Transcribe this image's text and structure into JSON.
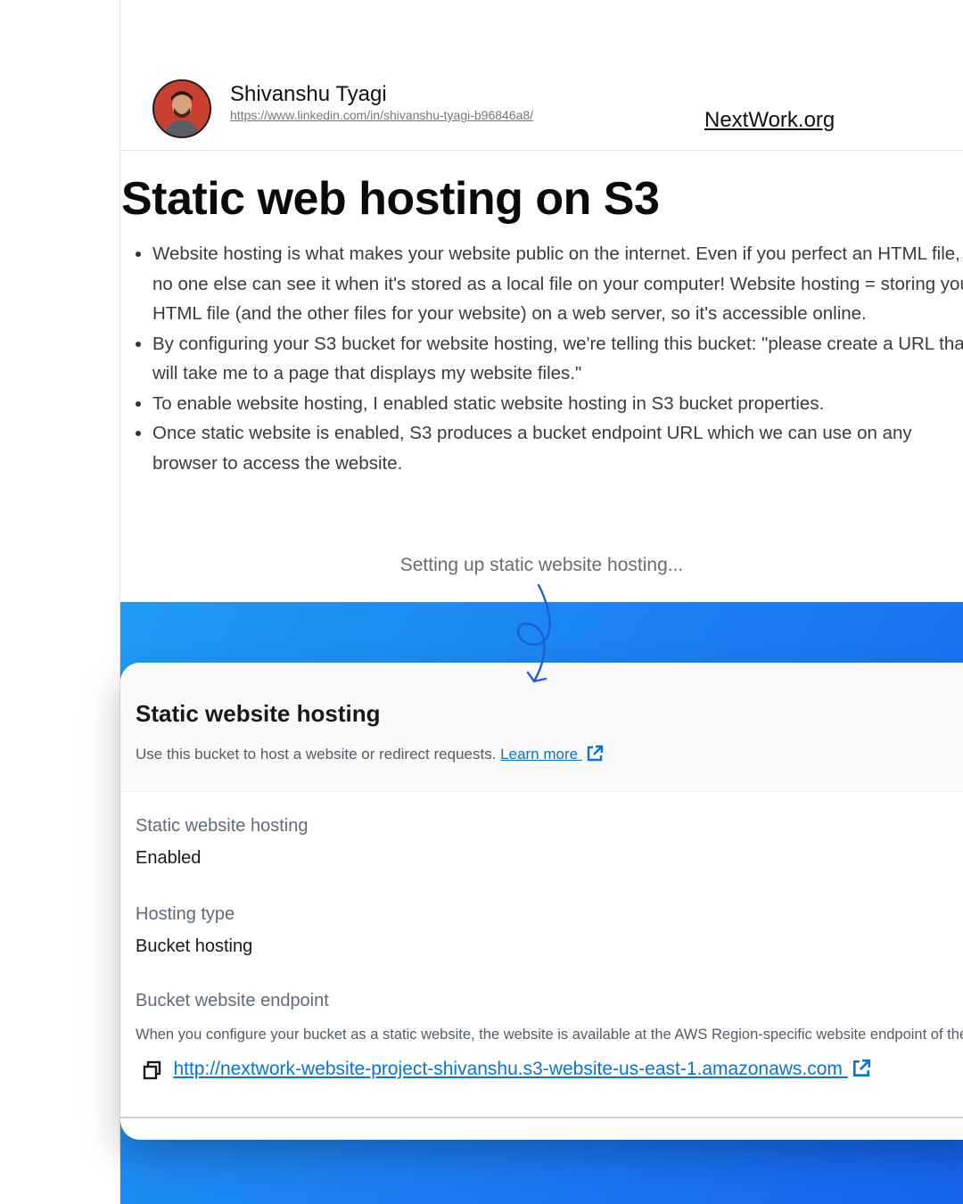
{
  "author": {
    "name": "Shivanshu Tyagi",
    "profile_url": "https://www.linkedin.com/in/shivanshu-tyagi-b96846a8/"
  },
  "brand": "NextWork.org",
  "section_title": "Static web hosting on S3",
  "bullets": [
    "Website hosting is what makes your website public on the internet. Even if you perfect an HTML file, no one else can see it when it's stored as a local file on your computer! Website hosting = storing your HTML file (and the other files for your website) on a web server, so it's accessible online.",
    "By configuring your S3 bucket for website hosting, we're telling this bucket: \"please create a URL that will take me to a page that displays my website files.\"",
    "To enable website hosting, I enabled static website hosting in S3 bucket properties.",
    "Once static website is enabled, S3 produces a bucket endpoint URL which we can use on any browser to access the website."
  ],
  "screenshot_caption": "Setting up static website hosting...",
  "panel": {
    "title": "Static website hosting",
    "description": "Use this bucket to host a website or redirect requests.",
    "learn_more": "Learn more",
    "fields": [
      {
        "label": "Static website hosting",
        "value": "Enabled"
      },
      {
        "label": "Hosting type",
        "value": "Bucket hosting"
      }
    ],
    "endpoint_label": "Bucket website endpoint",
    "endpoint_description": "When you configure your bucket as a static website, the website is available at the AWS Region-specific website endpoint of the bucket.",
    "endpoint_url": "http://nextwork-website-project-shivanshu.s3-website-us-east-1.amazonaws.com"
  },
  "icons": {
    "external": "external-link-icon",
    "copy": "copy-icon",
    "arrow": "hand-drawn-arrow-icon"
  },
  "colors": {
    "link_blue": "#0972d3",
    "band_blue_start": "#1f9bf5",
    "band_blue_end": "#1763ee"
  }
}
